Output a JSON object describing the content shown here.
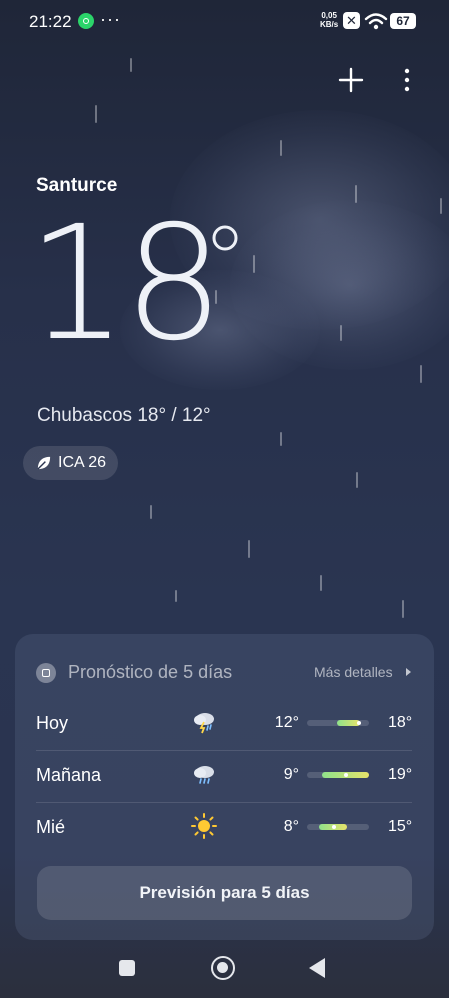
{
  "status_bar": {
    "time": "21:22",
    "overflow": "···",
    "net_speed_value": "0,05",
    "net_speed_unit": "KB/s",
    "battery": "67"
  },
  "location": {
    "city": "Santurce"
  },
  "current": {
    "temperature": "18",
    "condition_text": "Chubascos  18° / 12°",
    "aqi_label": "ICA 26"
  },
  "forecast": {
    "title": "Pronóstico de 5 días",
    "more_details": "Más detalles",
    "days": [
      {
        "day": "Hoy",
        "icon": "thunder-rain-icon",
        "low": "12°",
        "high": "18°"
      },
      {
        "day": "Mañana",
        "icon": "rain-cloud-icon",
        "low": "9°",
        "high": "19°"
      },
      {
        "day": "Mié",
        "icon": "sun-icon",
        "low": "8°",
        "high": "15°"
      }
    ],
    "five_day_button": "Previsión para 5 días"
  },
  "colors": {
    "background_top": "#1f2638",
    "background_mid": "#2a3551",
    "range_start": "#8fe28b",
    "range_end": "#e7e36a",
    "whatsapp": "#2bd46a"
  }
}
